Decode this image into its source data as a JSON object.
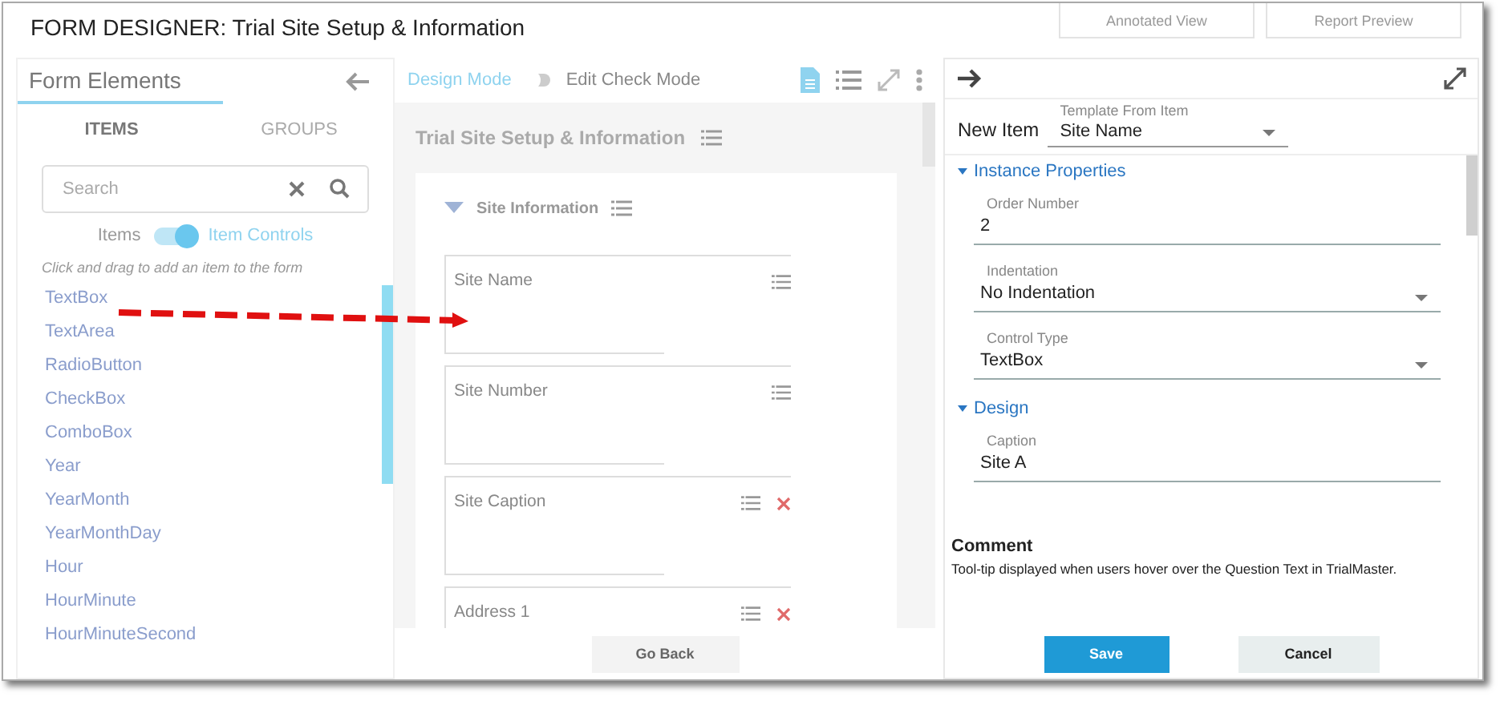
{
  "window": {
    "title": "FORM DESIGNER: Trial Site Setup & Information"
  },
  "top_buttons": [
    "Annotated View",
    "Report Preview"
  ],
  "left_panel": {
    "title": "Form Elements",
    "tabs": [
      {
        "label": "ITEMS",
        "selected": true
      },
      {
        "label": "GROUPS",
        "selected": false
      }
    ],
    "search": {
      "placeholder": "Search"
    },
    "toggle": {
      "left": "Items",
      "right": "Item Controls",
      "on": true
    },
    "hint": "Click and drag to add an item to the form",
    "items": [
      "TextBox",
      "TextArea",
      "RadioButton",
      "CheckBox",
      "ComboBox",
      "Year",
      "YearMonth",
      "YearMonthDay",
      "Hour",
      "HourMinute",
      "HourMinuteSecond"
    ]
  },
  "middle_panel": {
    "mode_toggle": {
      "left": "Design Mode",
      "right": "Edit Check Mode",
      "on": false
    },
    "form_title": "Trial Site Setup & Information",
    "section": {
      "title": "Site Information",
      "expanded": true
    },
    "fields": [
      {
        "label": "Site Name",
        "deletable": false
      },
      {
        "label": "Site Number",
        "deletable": false
      },
      {
        "label": "Site Caption",
        "deletable": true
      },
      {
        "label": "Address 1",
        "deletable": true
      }
    ],
    "footer_button": "Go Back"
  },
  "right_panel": {
    "new_item": "New Item",
    "template": {
      "label": "Template From Item",
      "value": "Site Name"
    },
    "sections": [
      {
        "title": "Instance Properties",
        "expanded": true,
        "fields": [
          {
            "kind": "text",
            "label": "Order Number",
            "value": "2"
          },
          {
            "kind": "select",
            "label": "Indentation",
            "value": "No Indentation"
          },
          {
            "kind": "select",
            "label": "Control Type",
            "value": "TextBox"
          }
        ]
      },
      {
        "title": "Design",
        "expanded": true,
        "fields": [
          {
            "kind": "text",
            "label": "Caption",
            "value": "Site A"
          }
        ]
      }
    ],
    "comment": {
      "title": "Comment",
      "text": "Tool-tip displayed when users hover over the Question Text in TrialMaster."
    },
    "buttons": [
      {
        "label": "Save",
        "kind": "primary"
      },
      {
        "label": "Cancel",
        "kind": "secondary"
      }
    ]
  }
}
